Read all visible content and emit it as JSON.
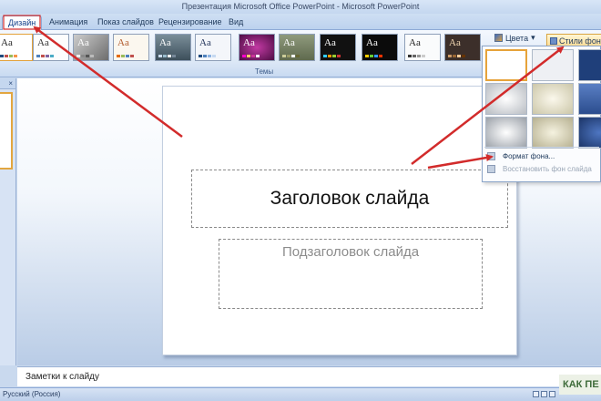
{
  "window": {
    "title": "Презентация Microsoft Office PowerPoint - Microsoft PowerPoint"
  },
  "tabs": [
    {
      "label": "Дизайн",
      "active": true
    },
    {
      "label": "Анимация",
      "active": false
    },
    {
      "label": "Показ слайдов",
      "active": false
    },
    {
      "label": "Рецензирование",
      "active": false
    },
    {
      "label": "Вид",
      "active": false
    }
  ],
  "ribbon": {
    "themes_group_label": "Темы",
    "theme_sample": "Aa",
    "colors_label": "Цвета",
    "colors_arrow": "▾",
    "background_styles_label": "Стили фона",
    "background_styles_arrow": "▾"
  },
  "left_panel": {
    "close_glyph": "×"
  },
  "slide": {
    "title_placeholder": "Заголовок слайда",
    "subtitle_placeholder": "Подзаголовок слайда"
  },
  "background_dropdown": {
    "format_background": "Формат фона...",
    "reset_background": "Восстановить фон слайда"
  },
  "notes": {
    "placeholder": "Заметки к слайду"
  },
  "statusbar": {
    "language": "Русский (Россия)"
  },
  "watermark": {
    "text": "КАК ПЕ"
  },
  "colors": {
    "annotation_arrow": "#d22b2b",
    "selection_highlight": "#e6a33a"
  }
}
